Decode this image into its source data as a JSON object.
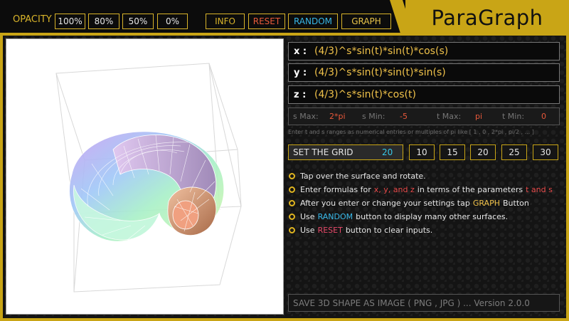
{
  "app": {
    "title": "ParaGraph"
  },
  "toolbar": {
    "opacity_label": "OPACITY",
    "opacity_options": [
      "100%",
      "80%",
      "50%",
      "0%"
    ],
    "info": "INFO",
    "reset": "RESET",
    "random": "RANDOM",
    "graph": "GRAPH"
  },
  "formulas": {
    "x": {
      "axis": "x :",
      "value": "(4/3)^s*sin(t)*sin(t)*cos(s)"
    },
    "y": {
      "axis": "y :",
      "value": "(4/3)^s*sin(t)*sin(t)*sin(s)"
    },
    "z": {
      "axis": "z :",
      "value": "(4/3)^s*sin(t)*cos(t)"
    }
  },
  "ranges": {
    "s_max_label": "s Max:",
    "s_max": "2*pi",
    "s_min_label": "s Min:",
    "s_min": "-5",
    "t_max_label": "t Max:",
    "t_max": "pi",
    "t_min_label": "t Min:",
    "t_min": "0",
    "hint": "Enter t and s ranges as numerical entries or multiples of pi like [ 1 , 0 , 2*pi , pi/2 , ... ]"
  },
  "grid": {
    "label": "SET THE GRID",
    "current": "20",
    "options": [
      "10",
      "15",
      "20",
      "25",
      "30"
    ]
  },
  "tips": {
    "t1": "Tap over the surface and rotate.",
    "t2_a": "Enter formulas for",
    "t2_hl": "x, y, and z",
    "t2_b": "in terms of  the parameters",
    "t2_hl2": "t  and  s",
    "t3_a": "After you enter or change your settings tap",
    "t3_hl": "GRAPH",
    "t3_b": "Button",
    "t4_a": "Use",
    "t4_hl": "RANDOM",
    "t4_b": "button to display many other surfaces.",
    "t5_a": "Use",
    "t5_hl": "RESET",
    "t5_b": "button to clear inputs."
  },
  "footer": {
    "save": "SAVE 3D SHAPE  AS IMAGE  ( PNG , JPG )  ...   Version 2.0.0"
  }
}
